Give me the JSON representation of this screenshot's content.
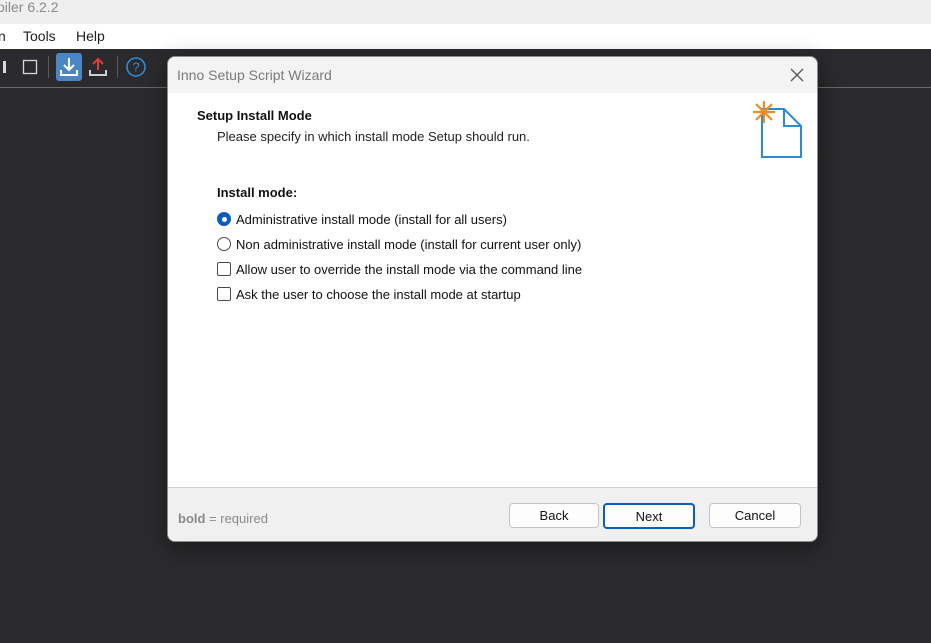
{
  "app": {
    "title": "oiler 6.2.2",
    "menu": [
      "n",
      "Tools",
      "Help"
    ]
  },
  "toolbar": {
    "icons": [
      "stop-icon",
      "square-icon",
      "download-icon",
      "upload-icon",
      "help-icon"
    ]
  },
  "dialog": {
    "title": "Inno Setup Script Wizard",
    "header_title": "Setup Install Mode",
    "header_subtitle": "Please specify in which install mode Setup should run.",
    "group_label": "Install mode:",
    "options": [
      {
        "type": "radio",
        "label": "Administrative install mode (install for all users)",
        "checked": true
      },
      {
        "type": "radio",
        "label": "Non administrative install mode (install for current user only)",
        "checked": false
      },
      {
        "type": "checkbox",
        "label": "Allow user to override the install mode via the command line",
        "checked": false
      },
      {
        "type": "checkbox",
        "label": "Ask the user to choose the install mode at startup",
        "checked": false
      }
    ],
    "footer_note_bold": "bold",
    "footer_note_rest": " = required",
    "buttons": {
      "back": "Back",
      "next": "Next",
      "cancel": "Cancel"
    }
  },
  "colors": {
    "accent": "#0b5cc2",
    "background": "#2b2b2d",
    "icon_orange": "#f08a24",
    "icon_blue": "#2d8ad6",
    "icon_red": "#e23b3b"
  }
}
